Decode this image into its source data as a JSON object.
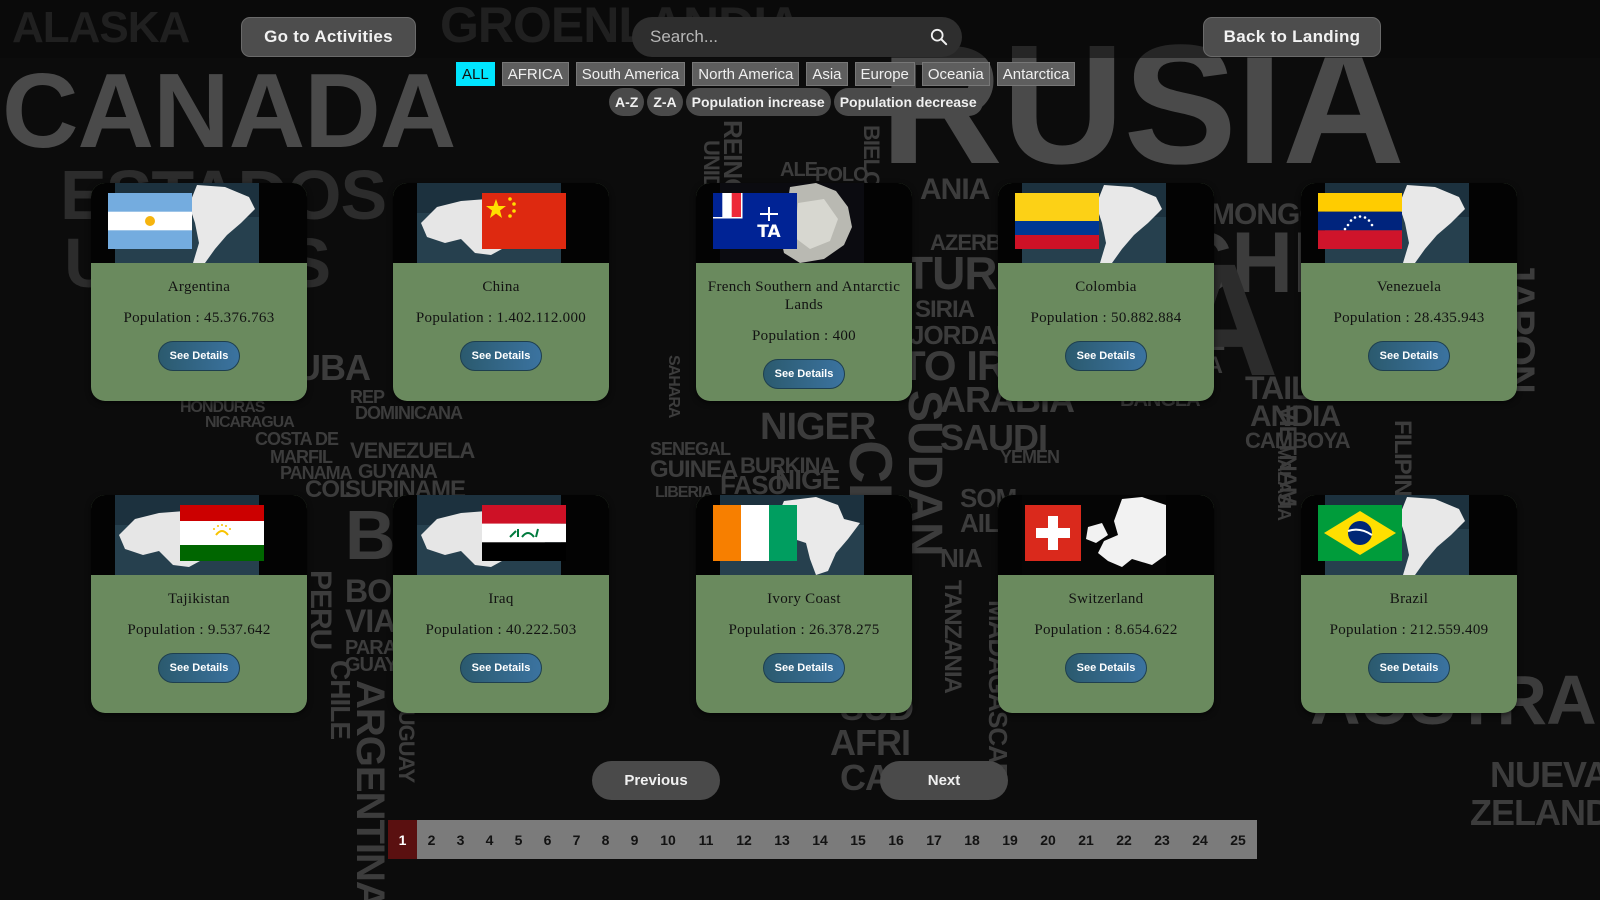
{
  "header": {
    "activities_label": "Go to Activities",
    "search_placeholder": "Search...",
    "landing_label": "Back to Landing"
  },
  "filters": [
    "ALL",
    "AFRICA",
    "South America",
    "North America",
    "Asia",
    "Europe",
    "Oceania",
    "Antarctica"
  ],
  "active_filter": "ALL",
  "sorts": [
    "A-Z",
    "Z-A",
    "Population increase",
    "Population decrease"
  ],
  "cards": [
    {
      "name": "Argentina",
      "population": "Population : 45.376.763",
      "button": "See Details",
      "flag": "argentina-flag",
      "map": "south-america-map"
    },
    {
      "name": "China",
      "population": "Population : 1.402.112.000",
      "button": "See Details",
      "flag": "china-flag",
      "map": "asia-map"
    },
    {
      "name": "French Southern and Antarctic Lands",
      "population": "Population : 400",
      "button": "See Details",
      "flag": "french-southern-lands-flag",
      "map": "antarctica-map"
    },
    {
      "name": "Colombia",
      "population": "Population : 50.882.884",
      "button": "See Details",
      "flag": "colombia-flag",
      "map": "south-america-map"
    },
    {
      "name": "Venezuela",
      "population": "Population : 28.435.943",
      "button": "See Details",
      "flag": "venezuela-flag",
      "map": "south-america-map"
    },
    {
      "name": "Tajikistan",
      "population": "Population : 9.537.642",
      "button": "See Details",
      "flag": "tajikistan-flag",
      "map": "asia-map"
    },
    {
      "name": "Iraq",
      "population": "Population : 40.222.503",
      "button": "See Details",
      "flag": "iraq-flag",
      "map": "asia-map"
    },
    {
      "name": "Ivory Coast",
      "population": "Population : 26.378.275",
      "button": "See Details",
      "flag": "ivory-coast-flag",
      "map": "africa-map"
    },
    {
      "name": "Switzerland",
      "population": "Population : 8.654.622",
      "button": "See Details",
      "flag": "switzerland-flag",
      "map": "europe-map"
    },
    {
      "name": "Brazil",
      "population": "Population : 212.559.409",
      "button": "See Details",
      "flag": "brazil-flag",
      "map": "south-america-map"
    }
  ],
  "pagination": {
    "previous_label": "Previous",
    "next_label": "Next",
    "pages": [
      "1",
      "2",
      "3",
      "4",
      "5",
      "6",
      "7",
      "8",
      "9",
      "10",
      "11",
      "12",
      "13",
      "14",
      "15",
      "16",
      "17",
      "18",
      "19",
      "20",
      "21",
      "22",
      "23",
      "24",
      "25"
    ],
    "current_page": "1"
  },
  "colors": {
    "card_body": "#6a8a5e",
    "active_filter": "#00e5ff",
    "active_page": "#5a1010",
    "details_button": "#3b73a0"
  }
}
